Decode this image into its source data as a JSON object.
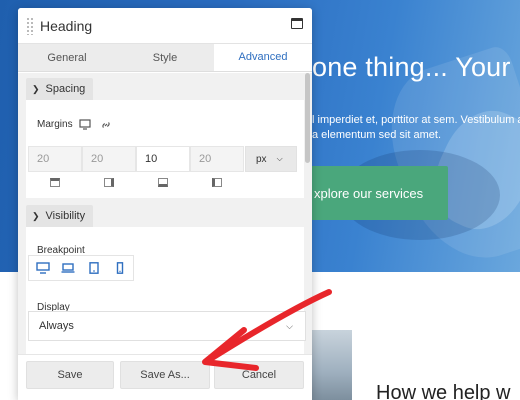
{
  "background_page": {
    "hero_title": "one thing... Your",
    "hero_text_line1": "l imperdiet et, porttitor at sem. Vestibulum a",
    "hero_text_line2": "a elementum sed sit amet.",
    "cta_label": "xplore our services",
    "section_heading": "How we help w",
    "colors": {
      "hero": "#2a6cc0",
      "cta": "#4aa77c"
    }
  },
  "panel": {
    "title": "Heading",
    "tabs": [
      {
        "label": "General",
        "active": false
      },
      {
        "label": "Style",
        "active": false
      },
      {
        "label": "Advanced",
        "active": true
      }
    ],
    "spacing": {
      "section_label": "Spacing",
      "margins_label": "Margins",
      "margins": [
        {
          "side": "top",
          "value": "",
          "placeholder": "20"
        },
        {
          "side": "right",
          "value": "",
          "placeholder": "20"
        },
        {
          "side": "bottom",
          "value": "10",
          "placeholder": ""
        },
        {
          "side": "left",
          "value": "",
          "placeholder": "20"
        }
      ],
      "unit": "px",
      "icons": [
        "desktop-icon",
        "link-icon"
      ]
    },
    "visibility": {
      "section_label": "Visibility",
      "breakpoint_label": "Breakpoint",
      "breakpoint_icons": [
        "desktop-icon",
        "laptop-icon",
        "tablet-icon",
        "phone-icon"
      ],
      "display_label": "Display",
      "display_value": "Always"
    },
    "footer": {
      "save_label": "Save",
      "save_as_label": "Save As...",
      "cancel_label": "Cancel"
    },
    "accent_color": "#2f6fc0"
  },
  "annotation": {
    "arrow_color": "#e8262b"
  }
}
